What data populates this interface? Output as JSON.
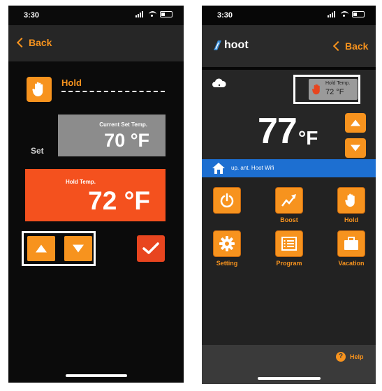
{
  "left": {
    "status_time": "3:30",
    "back_label": "Back",
    "hold_label": "Hold",
    "set_label": "Set",
    "current_set_label": "Current Set Temp.",
    "current_set_value": "70 °F",
    "hold_temp_label": "Hold Temp.",
    "hold_temp_value": "72 °F"
  },
  "right": {
    "status_time": "3:30",
    "logo_text": "hoot",
    "back_label": "Back",
    "hold_badge_label": "Hold Temp.",
    "hold_badge_value": "72 °F",
    "temperature": "77",
    "unit": "°F",
    "wifi_banner": "up. ant. Hoot Wifi",
    "grid": [
      {
        "label": ""
      },
      {
        "label": "Boost"
      },
      {
        "label": "Hold"
      },
      {
        "label": "Setting"
      },
      {
        "label": "Program"
      },
      {
        "label": "Vacation"
      }
    ],
    "help_label": "Help"
  },
  "colors": {
    "orange": "#f7931e",
    "red_orange": "#f4511e",
    "gray_box": "#8c8c8c",
    "wifi_blue": "#1d6fd1",
    "check_red": "#e8451f"
  }
}
